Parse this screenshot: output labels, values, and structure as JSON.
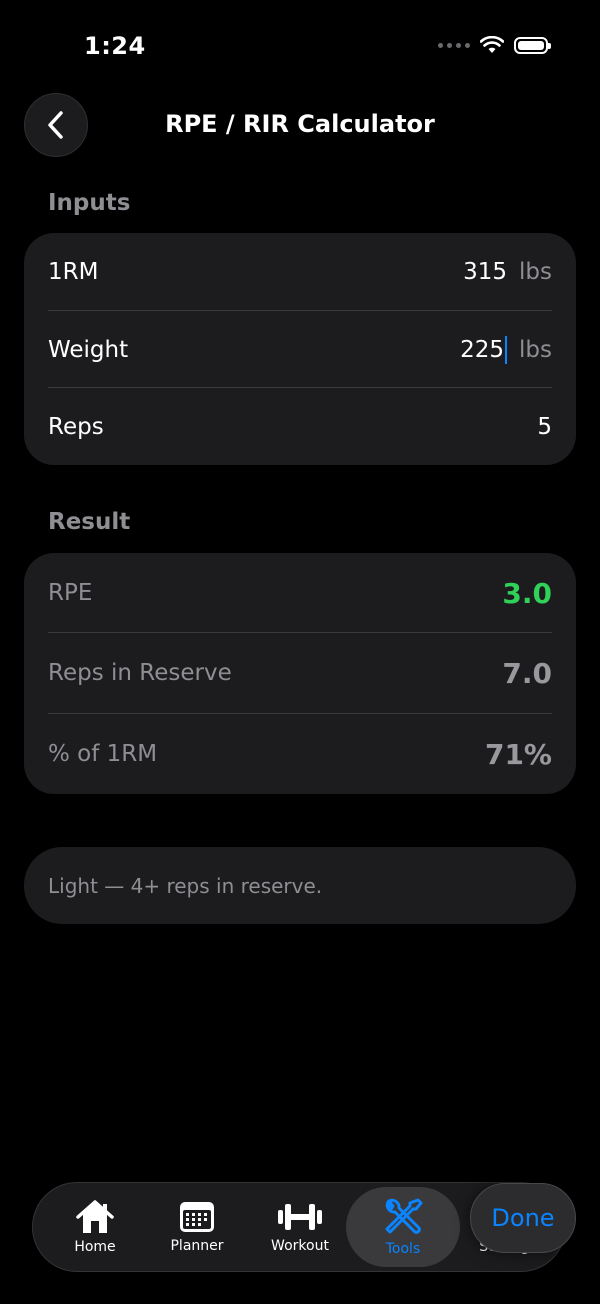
{
  "status": {
    "time": "1:24"
  },
  "header": {
    "title": "RPE / RIR Calculator"
  },
  "inputs": {
    "section_label": "Inputs",
    "rows": [
      {
        "label": "1RM",
        "value": "315",
        "unit": "lbs"
      },
      {
        "label": "Weight",
        "value": "225",
        "unit": "lbs"
      },
      {
        "label": "Reps",
        "value": "5"
      }
    ]
  },
  "result": {
    "section_label": "Result",
    "rows": [
      {
        "label": "RPE",
        "value": "3.0"
      },
      {
        "label": "Reps in Reserve",
        "value": "7.0"
      },
      {
        "label": "% of 1RM",
        "value": "71%"
      }
    ]
  },
  "note": {
    "text": "Light — 4+ reps in reserve."
  },
  "tabbar": {
    "tabs": [
      {
        "label": "Home",
        "icon": "house-icon"
      },
      {
        "label": "Planner",
        "icon": "calendar-icon"
      },
      {
        "label": "Workout",
        "icon": "dumbbell-icon"
      },
      {
        "label": "Tools",
        "icon": "wrench-screwdriver-icon",
        "active": true
      },
      {
        "label": "Settings",
        "icon": "gear-icon"
      }
    ],
    "done_label": "Done"
  },
  "colors": {
    "accent": "#0a84ff",
    "success": "#30d158",
    "card": "#1c1c1e",
    "background": "#000000"
  }
}
